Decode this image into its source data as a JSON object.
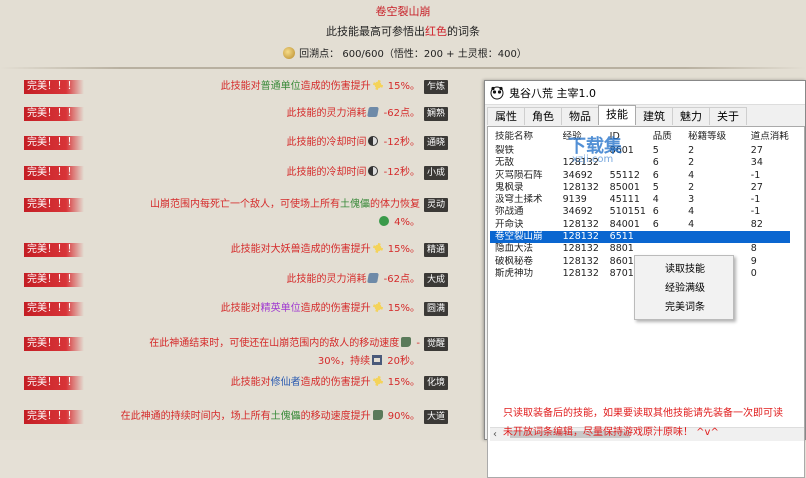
{
  "game": {
    "skill_title": "卷空裂山崩",
    "desc_pre": "此技能最高可参悟出",
    "desc_red": "红色",
    "desc_post": "的词条",
    "points": "回溯点： 600/600（悟性：200 + 土灵根：400）",
    "rows": [
      {
        "badge": "完美！！！",
        "pre": "此技能对",
        "hl": "普通单位",
        "hl_color": "#3a8a3a",
        "post": "造成的伤害提升",
        "icon": "sun",
        "val": " 15%。",
        "tag": "乍炼"
      },
      {
        "badge": "完美！！！",
        "pre": "此技能的灵力消耗",
        "hl": "",
        "hl_color": "",
        "post": "",
        "icon": "spirit",
        "val": " -62点。",
        "tag": "娴熟"
      },
      {
        "badge": "完美！！！",
        "pre": "此技能的冷却时间",
        "hl": "",
        "hl_color": "",
        "post": "",
        "icon": "moon",
        "val": " -12秒。",
        "tag": "通晓"
      },
      {
        "badge": "完美！！！",
        "pre": "此技能的冷却时间",
        "hl": "",
        "hl_color": "",
        "post": "",
        "icon": "moon",
        "val": " -12秒。",
        "tag": "小成"
      },
      {
        "badge": "完美！！！",
        "pre": "山崩范围内每死亡一个敌人，可使场上所有",
        "hl": "土傀儡",
        "hl_color": "#3a8a3a",
        "post": "的体力恢复",
        "icon": "heal",
        "val": " 4%。",
        "tag": "灵动",
        "line2": true
      },
      {
        "badge": "完美！！！",
        "pre": "此技能对大妖兽造成的伤害提升",
        "hl": "",
        "hl_color": "",
        "post": "",
        "icon": "sun",
        "val": " 15%。",
        "tag": "精通"
      },
      {
        "badge": "完美！！！",
        "pre": "此技能的灵力消耗",
        "hl": "",
        "hl_color": "",
        "post": "",
        "icon": "spirit",
        "val": " -62点。",
        "tag": "大成"
      },
      {
        "badge": "完美！！！",
        "pre": "此技能对",
        "hl": "精英单位",
        "hl_color": "#a03ad0",
        "post": "造成的伤害提升",
        "icon": "sun",
        "val": " 15%。",
        "tag": "圆满"
      },
      {
        "badge": "完美！！！",
        "pre": "在此神通结束时，可使还在山崩范围内的敌人的移动速度",
        "hl": "",
        "hl_color": "",
        "post": "",
        "icon": "shoe",
        "val": " -",
        "line2txt": "30%，持续",
        "icon2": "glass",
        "val2": " 20秒。",
        "tag": "觉醒"
      },
      {
        "badge": "完美！！！",
        "pre": "此技能对",
        "hl": "修仙者",
        "hl_color": "#2a5ab0",
        "post": "造成的伤害提升",
        "icon": "sun",
        "val": " 15%。",
        "tag": "化境"
      },
      {
        "badge": "完美！！！",
        "pre": "在此神通的持续时间内，场上所有",
        "hl": "土傀儡",
        "hl_color": "#3a8a3a",
        "post": "的移动速度提升",
        "icon": "shoe",
        "val": " 90%。",
        "tag": "大道",
        "line2only": true
      }
    ]
  },
  "window": {
    "title": "鬼谷八荒 主宰1.0",
    "tabs": [
      "属性",
      "角色",
      "物品",
      "技能",
      "建筑",
      "魅力",
      "关于"
    ],
    "active_tab": "技能",
    "columns": [
      "技能名称",
      "经验",
      "ID",
      "品质",
      "秘籍等级",
      "道点消耗"
    ],
    "rows": [
      [
        "裂铁",
        "",
        "",
        "5",
        "2",
        "27"
      ],
      [
        "无敌",
        "128132",
        "",
        "6",
        "2",
        "34"
      ],
      [
        "灭骂陨石阵",
        "34692",
        "55112",
        "6",
        "4",
        "-1"
      ],
      [
        "鬼枫录",
        "128132",
        "85001",
        "5",
        "2",
        "27"
      ],
      [
        "汲穹土揉术",
        "9139",
        "45111",
        "4",
        "3",
        "-1"
      ],
      [
        "弥战通",
        "34692",
        "510151",
        "6",
        "4",
        "-1"
      ],
      [
        "开命诀",
        "128132",
        "84001",
        "6",
        "4",
        "82"
      ],
      [
        "卷空裂山崩",
        "128132",
        "6511",
        "",
        "",
        ""
      ],
      [
        "隐血大法",
        "128132",
        "8801",
        "",
        "",
        "8"
      ],
      [
        "破枫秘卷",
        "128132",
        "8601",
        "",
        "",
        "9"
      ],
      [
        "斯虎神功",
        "128132",
        "8701",
        "",
        "",
        "0"
      ]
    ],
    "partial_id_row0": "8601",
    "selected_row": 7,
    "notice_line1": "只读取装备后的技能，如果要读取其他技能请先装备一次即可读",
    "notice_line2": "未开放词条编辑，尽量保持游戏原汁原味！ ^v^",
    "context_menu": [
      "读取技能",
      "经验满级",
      "完美词条"
    ],
    "watermark_title": "下载集",
    "watermark_sub": "xzji.com"
  }
}
